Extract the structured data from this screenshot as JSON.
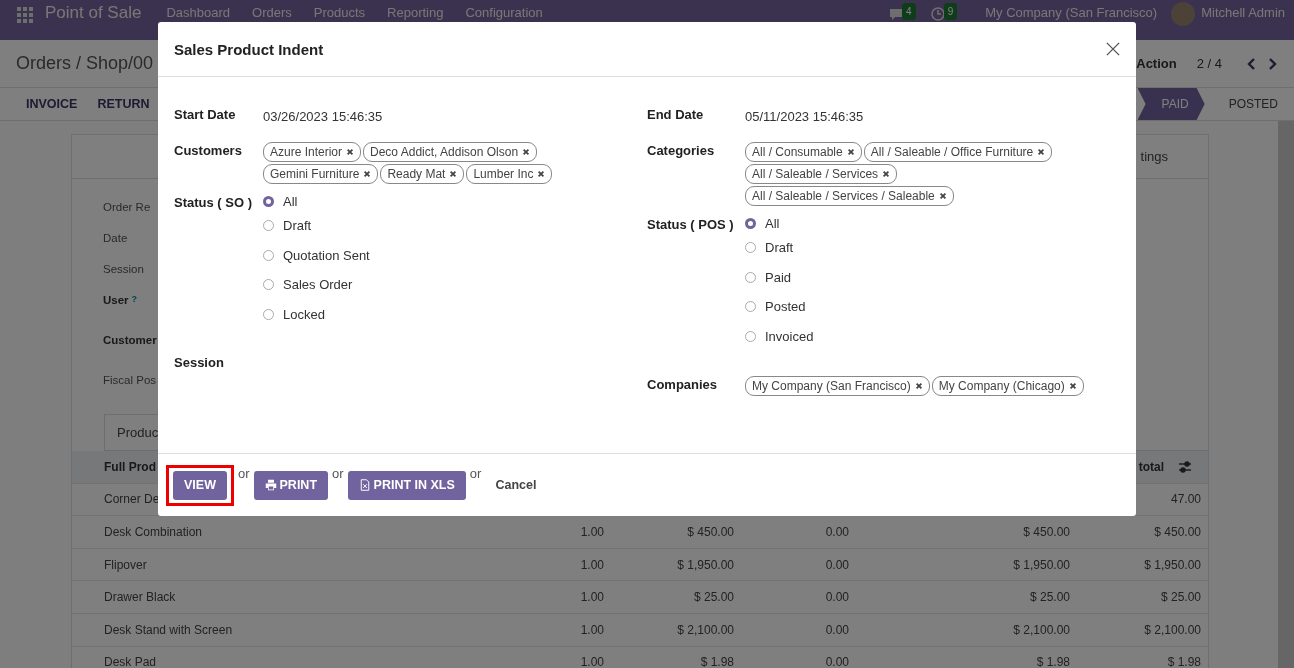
{
  "navbar": {
    "app_name": "Point of Sale",
    "menu": [
      "Dashboard",
      "Orders",
      "Products",
      "Reporting",
      "Configuration"
    ],
    "messages_badge": "4",
    "activities_badge": "9",
    "company": "My Company (San Francisco)",
    "user": "Mitchell Admin"
  },
  "control_panel": {
    "breadcrumb": "Orders / Shop/00",
    "action": "Action",
    "pager": "2 / 4"
  },
  "action_buttons": [
    "INVOICE",
    "RETURN"
  ],
  "statusbar": [
    {
      "label": "PAID",
      "selected": true
    },
    {
      "label": "POSTED",
      "selected": false
    }
  ],
  "sheet": {
    "tab_label": "tings",
    "fields": [
      {
        "label": "Order Re",
        "required": false
      },
      {
        "label": "Date",
        "required": false
      },
      {
        "label": "Session",
        "required": false
      },
      {
        "label": "User",
        "required": true,
        "help": "?"
      },
      {
        "label": "Customer",
        "required": true
      },
      {
        "label": "Fiscal Pos",
        "required": false
      }
    ],
    "notebook_tab": "Produc",
    "table": {
      "columns": [
        {
          "label": "Full Prod",
          "kind": "name"
        },
        {
          "label": "total",
          "kind": "total"
        }
      ],
      "rows": [
        {
          "product": "Corner De",
          "subtotal": "47.00"
        },
        {
          "product": "Desk Combination",
          "quantity": "1.00",
          "unit_price": "$ 450.00",
          "discount": "0.00",
          "subtotal_excl": "$ 450.00",
          "subtotal": "$ 450.00"
        },
        {
          "product": "Flipover",
          "quantity": "1.00",
          "unit_price": "$ 1,950.00",
          "discount": "0.00",
          "subtotal_excl": "$ 1,950.00",
          "subtotal": "$ 1,950.00"
        },
        {
          "product": "Drawer Black",
          "quantity": "1.00",
          "unit_price": "$ 25.00",
          "discount": "0.00",
          "subtotal_excl": "$ 25.00",
          "subtotal": "$ 25.00"
        },
        {
          "product": "Desk Stand with Screen",
          "quantity": "1.00",
          "unit_price": "$ 2,100.00",
          "discount": "0.00",
          "subtotal_excl": "$ 2,100.00",
          "subtotal": "$ 2,100.00"
        },
        {
          "product": "Desk Pad",
          "quantity": "1.00",
          "unit_price": "$ 1.98",
          "discount": "0.00",
          "subtotal_excl": "$ 1.98",
          "subtotal": "$ 1.98"
        }
      ]
    }
  },
  "dialog": {
    "title": "Sales Product Indent",
    "left_fields": [
      {
        "kind": "text",
        "label": "Start Date",
        "value": "03/26/2023 15:46:35"
      },
      {
        "kind": "tags",
        "label": "Customers",
        "tags": [
          "Azure Interior",
          "Deco Addict, Addison Olson",
          "Gemini Furniture",
          "Ready Mat",
          "Lumber Inc"
        ]
      },
      {
        "kind": "radio",
        "label": "Status ( SO )",
        "options": [
          {
            "label": "All",
            "selected": true
          },
          {
            "label": "Draft",
            "selected": false
          },
          {
            "label": "Quotation Sent",
            "selected": false
          },
          {
            "label": "Sales Order",
            "selected": false
          },
          {
            "label": "Locked",
            "selected": false
          }
        ]
      },
      {
        "kind": "empty",
        "label": "Session"
      }
    ],
    "right_fields": [
      {
        "kind": "text",
        "label": "End Date",
        "value": "05/11/2023 15:46:35"
      },
      {
        "kind": "tags",
        "label": "Categories",
        "tags": [
          "All / Consumable",
          "All / Saleable / Office Furniture",
          "All / Saleable / Services",
          "All / Saleable / Services / Saleable"
        ]
      },
      {
        "kind": "radio",
        "label": "Status ( POS )",
        "options": [
          {
            "label": "All",
            "selected": true
          },
          {
            "label": "Draft",
            "selected": false
          },
          {
            "label": "Paid",
            "selected": false
          },
          {
            "label": "Posted",
            "selected": false
          },
          {
            "label": "Invoiced",
            "selected": false
          }
        ]
      },
      {
        "kind": "tags",
        "label": "Companies",
        "tags": [
          "My Company (San Francisco)",
          "My Company (Chicago)"
        ]
      }
    ],
    "buttons": [
      {
        "label": "VIEW",
        "highlighted": true
      },
      {
        "label": "PRINT",
        "highlighted": false
      },
      {
        "label": "PRINT IN XLS",
        "highlighted": false
      }
    ],
    "separators": [
      "or",
      "or",
      "or"
    ],
    "cancel": "Cancel"
  }
}
